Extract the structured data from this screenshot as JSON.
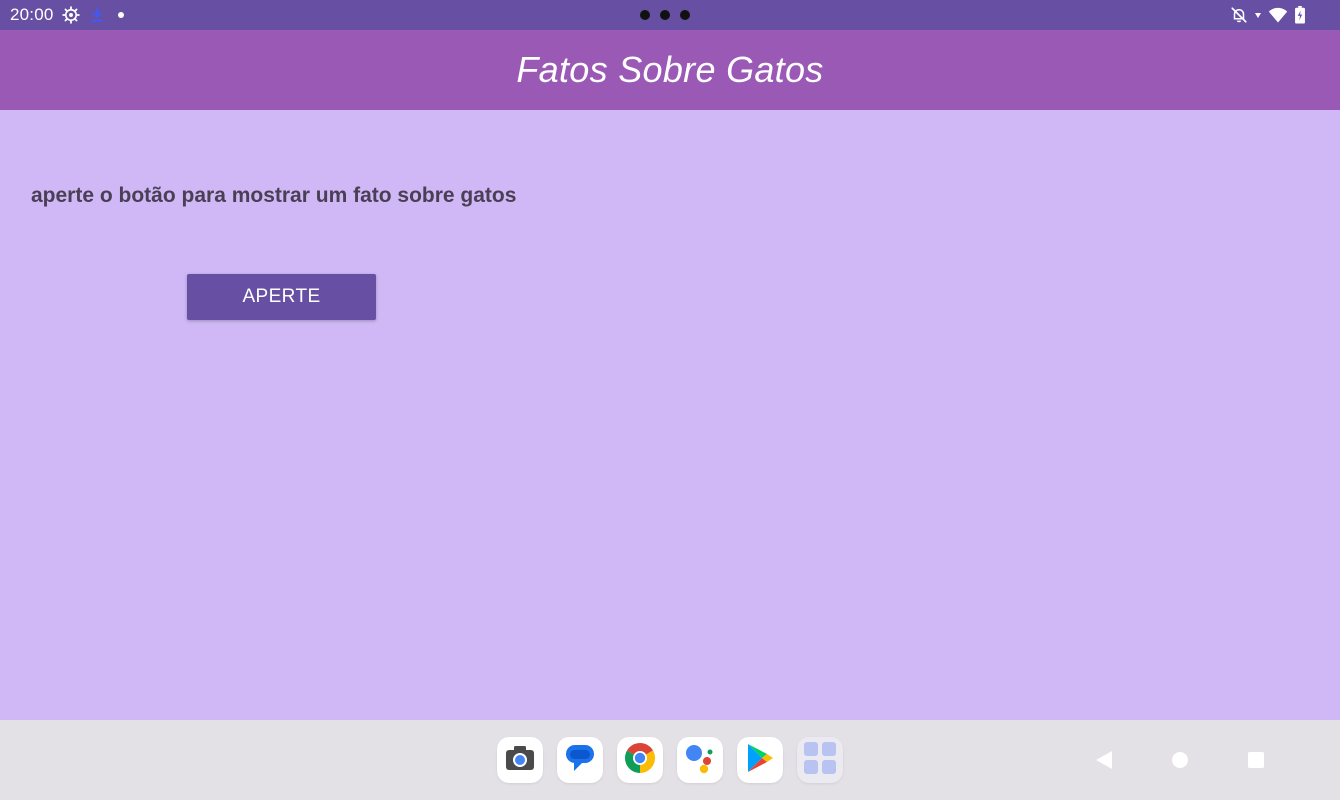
{
  "status_bar": {
    "time": "20:00",
    "icons": [
      "settings-icon",
      "download-icon",
      "notification-dot-icon",
      "bell-off-icon",
      "wifi-icon",
      "battery-icon"
    ]
  },
  "app_bar": {
    "title": "Fatos Sobre Gatos"
  },
  "content": {
    "prompt_text": "aperte o botão para mostrar um fato sobre gatos",
    "button_label": "APERTE"
  },
  "dock": {
    "apps": [
      "camera-icon",
      "messages-icon",
      "chrome-icon",
      "assistant-icon",
      "play-store-icon",
      "app-grid-icon"
    ]
  },
  "nav": {
    "buttons": [
      "back-icon",
      "home-icon",
      "recents-icon"
    ]
  },
  "colors": {
    "status_bar": "#6750a4",
    "app_bar": "#9b59b6",
    "background": "#cfb8f5",
    "button": "#6750a4",
    "nav_bar": "#e3e0e6"
  }
}
